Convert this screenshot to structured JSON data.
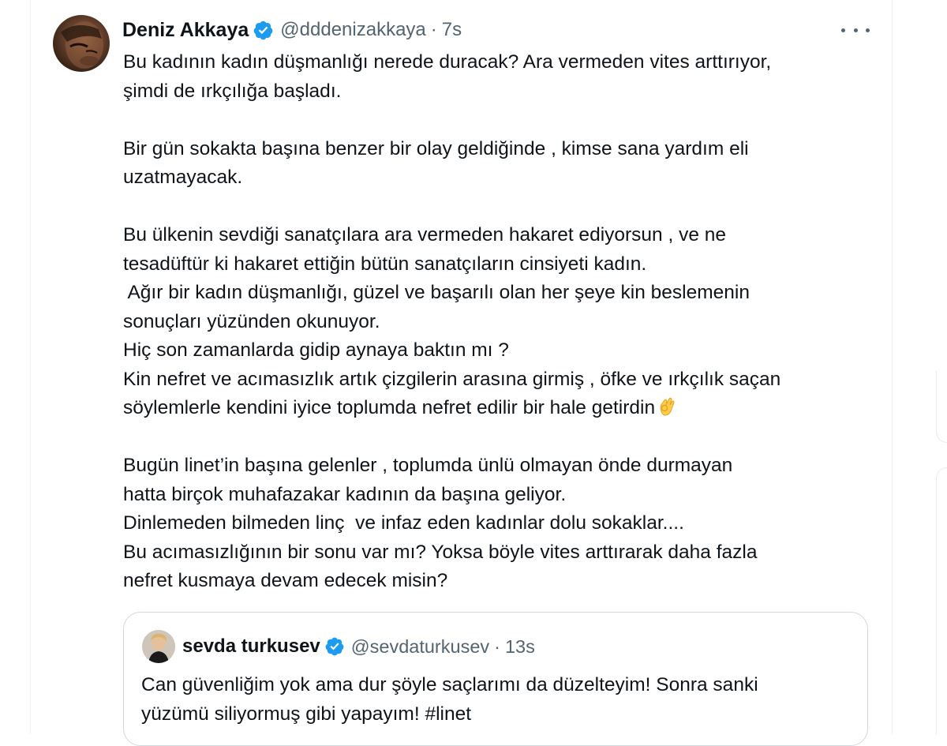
{
  "tweet": {
    "author_name": "Deniz Akkaya",
    "handle": "@dddenizakkaya",
    "separator": "·",
    "time": "7s",
    "lines": [
      "Bu kadının kadın düşmanlığı nerede duracak? Ara vermeden vites arttırıyor,",
      "şimdi de ırkçılığa başladı.",
      "",
      "Bir gün sokakta başına benzer bir olay geldiğinde , kimse sana yardım eli",
      "uzatmayacak.",
      "",
      "Bu ülkenin sevdiği sanatçılara ara vermeden hakaret ediyorsun , ve ne",
      "tesadüftür ki hakaret ettiğin bütün sanatçıların cinsiyeti kadın.",
      " Ağır bir kadın düşmanlığı, güzel ve başarılı olan her şeye kin beslemenin",
      "sonuçları yüzünden okunuyor.",
      "Hiç son zamanlarda gidip aynaya baktın mı ?",
      "Kin nefret ve acımasızlık artık çizgilerin arasına girmiş , öfke ve ırkçılık saçan",
      "söylemlerle kendini iyice toplumda nefret edilir bir hale getirdin",
      "",
      "Bugün linet’in başına gelenler , toplumda ünlü olmayan önde durmayan",
      "hatta birçok muhafazakar kadının da başına geliyor.",
      "Dinlemeden bilmeden linç  ve infaz eden kadınlar dolu sokaklar....",
      "Bu acımasızlığının bir sonu var mı? Yoksa böyle vites arttırarak daha fazla",
      "nefret kusmaya devam edecek misin?"
    ],
    "emoji": "ok-hand-emoji",
    "more_icon": "more-horizontal-icon",
    "verified_icon": "verified-badge-icon"
  },
  "quote": {
    "author_name": "sevda turkusev",
    "handle": "@sevdaturkusev",
    "separator": "·",
    "time": "13s",
    "lines": [
      "Can güvenliğim yok ama dur şöyle saçlarımı da düzelteyim! Sonra sanki",
      "yüzümü siliyormuş gibi yapayım! #linet"
    ]
  },
  "colors": {
    "text": "#0f1419",
    "secondary": "#536471",
    "verified": "#1d9bf0",
    "border": "#cfd9de"
  }
}
